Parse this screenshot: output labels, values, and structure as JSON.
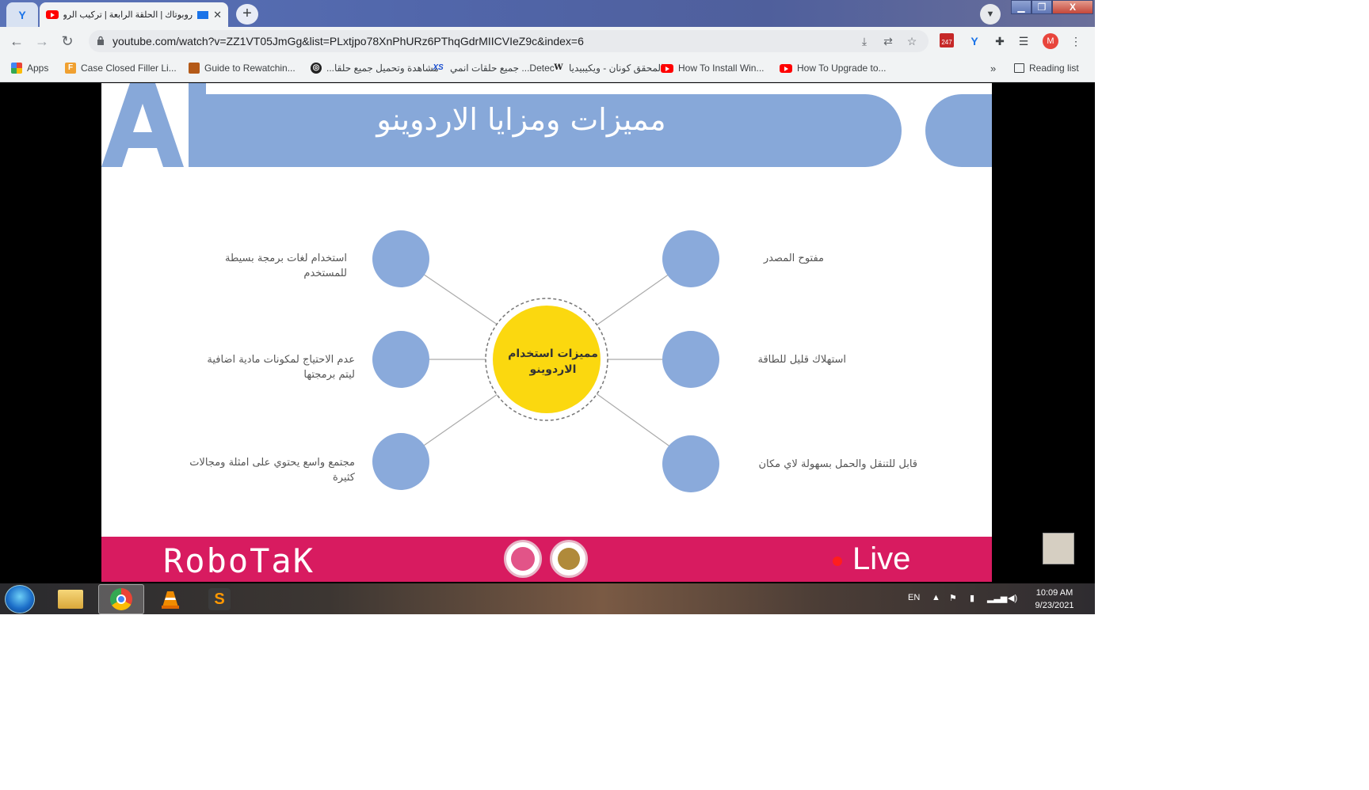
{
  "browser": {
    "tabs": [
      {
        "label": "روبوتاك | الحلقة الرابعة | تركيب الرو",
        "active": true
      }
    ],
    "url": "youtube.com/watch?v=ZZ1VT05JmGg&list=PLxtjpo78XnPhURz6PThqGdrMIICVIeZ9c&index=6",
    "profile_initial": "M",
    "extension_badge": "247"
  },
  "bookmarks": {
    "items": [
      {
        "label": "Apps",
        "icon": "apps-grid-icon"
      },
      {
        "label": "Case Closed Filler Li...",
        "icon": "f-icon",
        "color": "#f0a030"
      },
      {
        "label": "Guide to Rewatchin...",
        "icon": "bookmark-site-icon",
        "color": "#b45a18"
      },
      {
        "label": "مشاهدة وتحميل جميع حلقا...",
        "icon": "globe-icon",
        "color": "#222222"
      },
      {
        "label": "جميع حلقات انمي ...Detec",
        "icon": "xs-icon",
        "color": "#1a4fd0"
      },
      {
        "label": "المحقق كونان - ويكيبيديا",
        "icon": "wikipedia-icon",
        "color": "#222222"
      },
      {
        "label": "How To Install Win...",
        "icon": "youtube-icon",
        "color": "#ff0000"
      },
      {
        "label": "How To Upgrade to...",
        "icon": "youtube-icon",
        "color": "#ff0000"
      }
    ],
    "overflow": "»",
    "reading_list": "Reading list"
  },
  "slide": {
    "title": "مميزات ومزايا الاردوينو",
    "center_label": "مميزات استخدام الاردوينو",
    "features_left": [
      "استخدام لغات برمجة بسيطة للمستخدم",
      "عدم الاحتياج لمكونات مادية اضافية ليتم برمجتها",
      "مجتمع واسع يحتوي على امثلة ومجالات كثيرة"
    ],
    "features_right": [
      "مفتوح المصدر",
      "استهلاك قليل للطاقة",
      "قابل للتنقل والحمل بسهولة لاي مكان"
    ],
    "colors": {
      "banner": "#87a8d9",
      "node": "#8aaadb",
      "center": "#fbd80f",
      "footer": "#d81b60"
    }
  },
  "footer": {
    "brand": "RoboTaK",
    "live": "Live"
  },
  "taskbar": {
    "apps": [
      "file-explorer-icon",
      "chrome-icon",
      "vlc-icon",
      "sublime-text-icon"
    ],
    "language": "EN",
    "time": "10:09 AM",
    "date": "9/23/2021"
  }
}
